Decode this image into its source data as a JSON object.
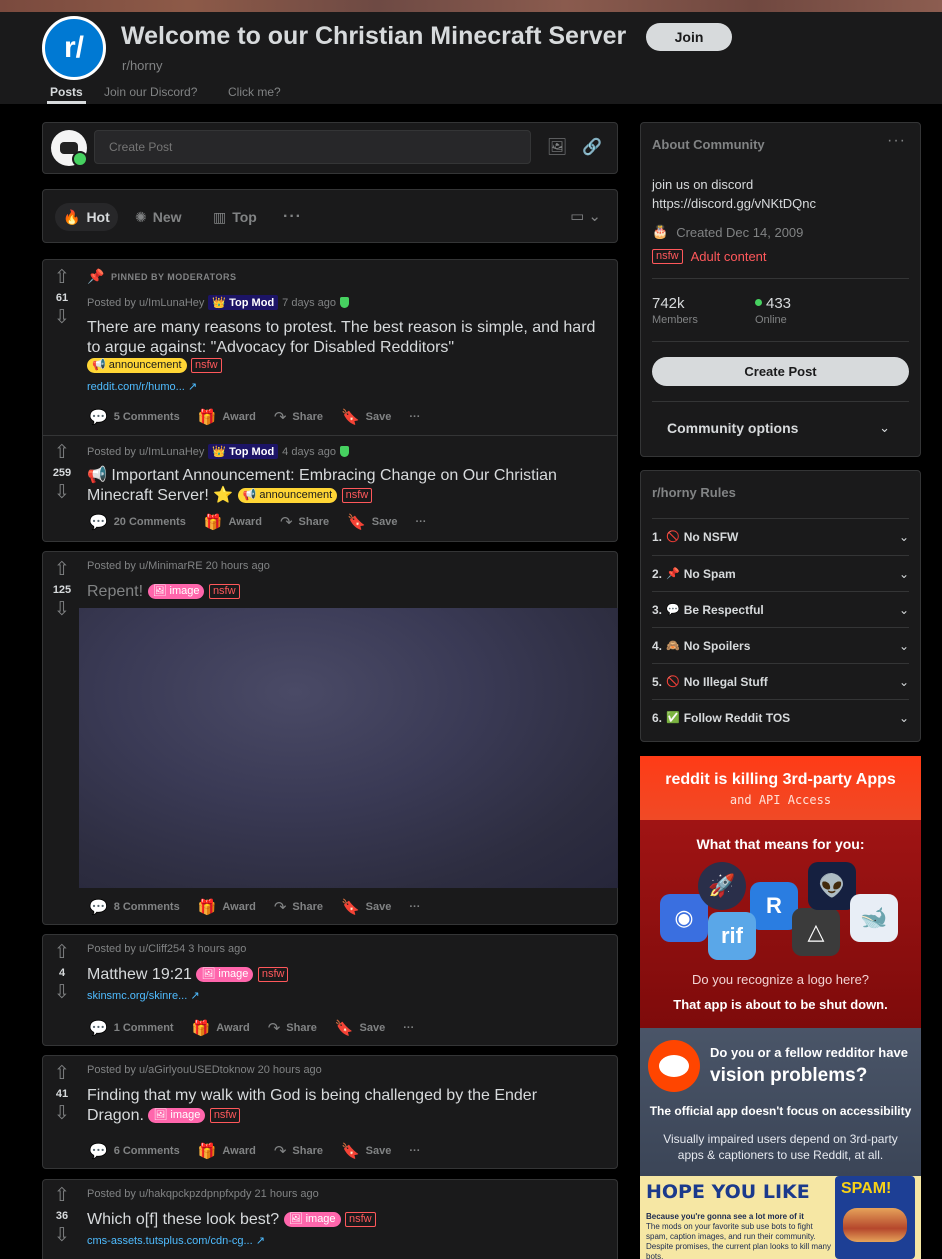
{
  "header": {
    "title": "Welcome to our Christian Minecraft Server",
    "subreddit": "r/horny",
    "icon_text": "r/",
    "join_label": "Join",
    "tabs": [
      "Posts",
      "Join our Discord?",
      "Click me?"
    ]
  },
  "create_post": {
    "placeholder": "Create Post"
  },
  "sort": {
    "hot": "Hot",
    "new": "New",
    "top": "Top"
  },
  "posts": [
    {
      "pinned_label": "PINNED BY MODERATORS",
      "score": "61",
      "author": "Posted by u/ImLunaHey",
      "mod_badge": "👑 Top Mod",
      "time": "7 days ago",
      "title": "There are many reasons to protest. The best reason is simple, and hard to argue against: \"Advocacy for Disabled Redditors\"",
      "flair": "📢 announcement",
      "nsfw": "nsfw",
      "link": "reddit.com/r/humo...",
      "comments": "5 Comments"
    },
    {
      "score": "259",
      "author": "Posted by u/ImLunaHey",
      "mod_badge": "👑 Top Mod",
      "time": "4 days ago",
      "title": "📢 Important Announcement: Embracing Change on Our Christian Minecraft Server! ⭐",
      "flair": "📢 announcement",
      "nsfw": "nsfw",
      "comments": "20 Comments"
    },
    {
      "score": "125",
      "author": "Posted by u/MinimarRE 20 hours ago",
      "title": "Repent!",
      "flair": "🖼 image",
      "nsfw": "nsfw",
      "comments": "8 Comments"
    },
    {
      "score": "4",
      "author": "Posted by u/Cliff254 3 hours ago",
      "title": "Matthew 19:21",
      "flair": "🖼 image",
      "nsfw": "nsfw",
      "link": "skinsmc.org/skinre...",
      "comments": "1 Comment"
    },
    {
      "score": "41",
      "author": "Posted by u/aGirlyouUSEDtoknow 20 hours ago",
      "title": "Finding that my walk with God is being challenged by the Ender Dragon.",
      "flair": "🖼 image",
      "nsfw": "nsfw",
      "comments": "6 Comments"
    },
    {
      "score": "36",
      "author": "Posted by u/hakqpckpzdpnpfxpdy 21 hours ago",
      "title": "Which o[f] these look best?",
      "flair": "🖼 image",
      "nsfw": "nsfw",
      "link": "cms-assets.tutsplus.com/cdn-cg..."
    }
  ],
  "actions": {
    "award": "Award",
    "share": "Share",
    "save": "Save"
  },
  "about": {
    "title": "About Community",
    "desc_line1": "join us on discord",
    "desc_line2": "https://discord.gg/vNKtDQnc",
    "created": "Created Dec 14, 2009",
    "nsfw_tag": "nsfw",
    "adult": "Adult content",
    "members": "742k",
    "members_label": "Members",
    "online": "433",
    "online_label": "Online",
    "create_post": "Create Post",
    "community_options": "Community options"
  },
  "rules": {
    "title": "r/horny Rules",
    "items": [
      {
        "num": "1.",
        "emoji": "🚫",
        "text": "No NSFW"
      },
      {
        "num": "2.",
        "emoji": "📌",
        "text": "No Spam"
      },
      {
        "num": "3.",
        "emoji": "💬",
        "text": "Be Respectful"
      },
      {
        "num": "4.",
        "emoji": "🙈",
        "text": "No Spoilers"
      },
      {
        "num": "5.",
        "emoji": "🚫",
        "text": "No Illegal Stuff"
      },
      {
        "num": "6.",
        "emoji": "✅",
        "text": "Follow Reddit TOS"
      }
    ]
  },
  "ad": {
    "headline": "reddit is killing 3rd-party Apps",
    "subhead": "and API Access",
    "what": "What that means for you:",
    "question": "Do you recognize a logo here?",
    "shutdown": "That app is about to be shut down.",
    "vision1": "Do you or a fellow redditor have",
    "vision2": "vision problems?",
    "official": "The official app doesn't focus on accessibility",
    "impaired": "Visually impaired users depend on 3rd-party apps & captioners to use Reddit, at all.",
    "hope": "HOPE YOU LIKE",
    "fine_bold": "Because you're gonna see a lot more of it",
    "fine": "The mods on your favorite sub use bots to fight spam, caption images, and run their community. Despite promises, the current plan looks to kill many bots,"
  },
  "colors": {
    "accent": "#0079d3",
    "nsfw": "#ff585b",
    "announcement": "#ffd635",
    "image_flair": "#ff66ac",
    "online": "#46d160"
  }
}
